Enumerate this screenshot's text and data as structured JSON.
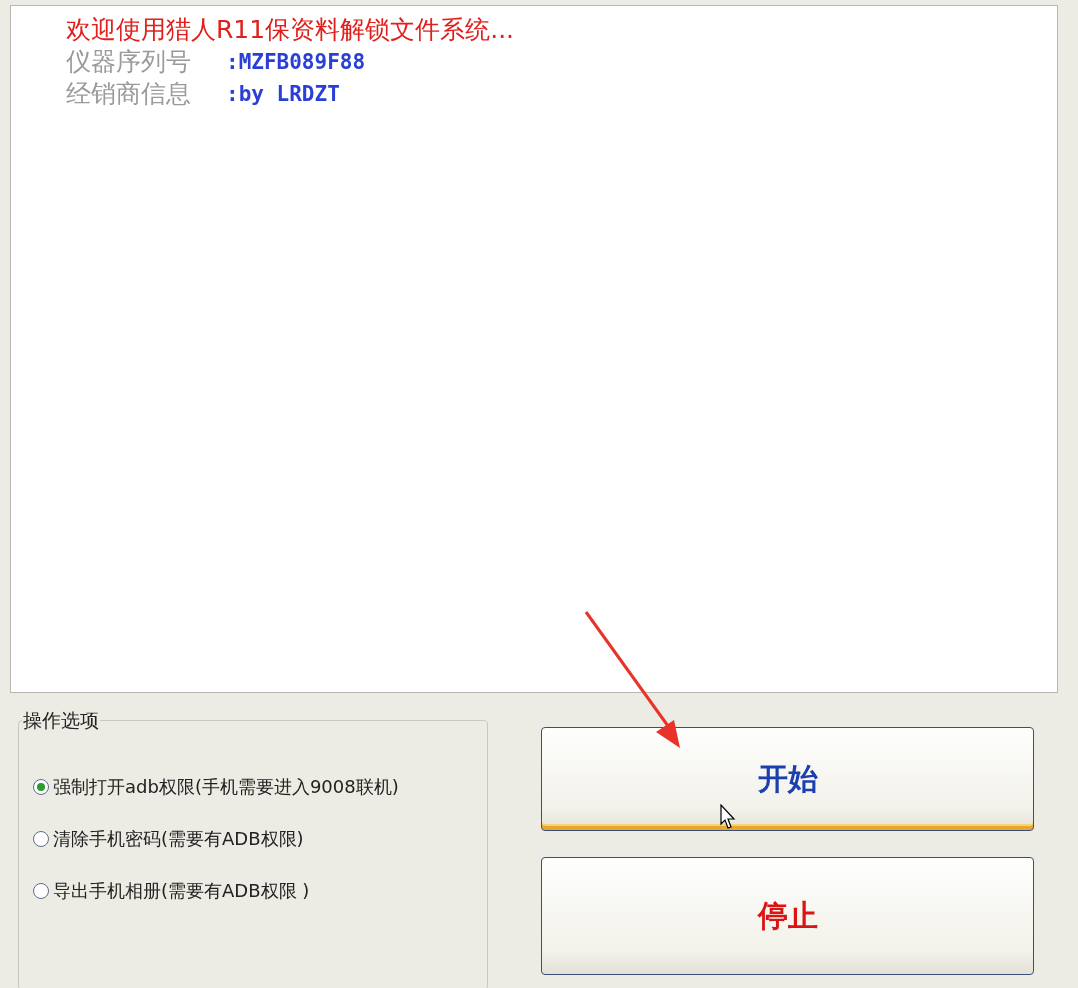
{
  "log": {
    "title": "欢迎使用猎人R11保资料解锁文件系统...",
    "fields": [
      {
        "label": "仪器序列号",
        "value": ":MZFB089F88"
      },
      {
        "label": "经销商信息",
        "value": ":by LRDZT"
      }
    ]
  },
  "options": {
    "title": "操作选项",
    "items": [
      {
        "label": "强制打开adb权限(手机需要进入9008联机)",
        "selected": true
      },
      {
        "label": "清除手机密码(需要有ADB权限)",
        "selected": false
      },
      {
        "label": "导出手机相册(需要有ADB权限 )",
        "selected": false
      }
    ]
  },
  "buttons": [
    {
      "label": "开始",
      "kind": "start",
      "hover": true
    },
    {
      "label": "停止",
      "kind": "stop",
      "hover": false
    }
  ]
}
